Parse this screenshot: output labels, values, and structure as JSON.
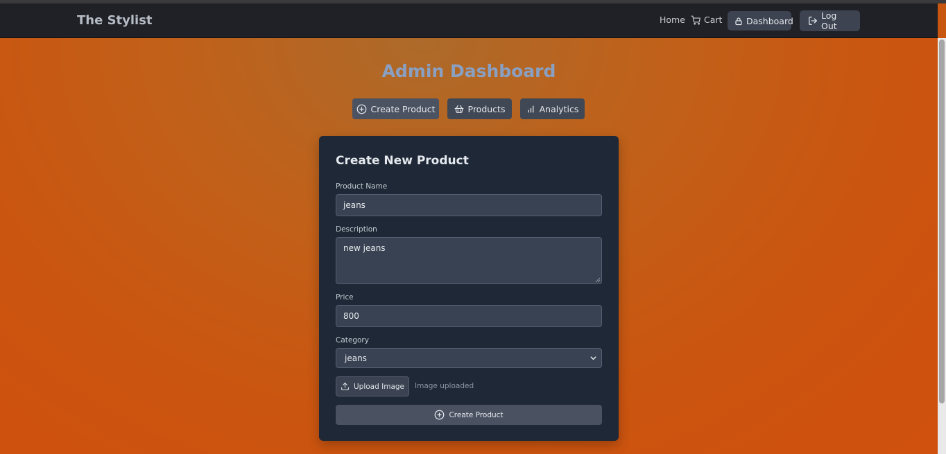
{
  "navbar": {
    "brand": "The Stylist",
    "home": "Home",
    "cart": "Cart",
    "dashboard": "Dashboard",
    "logout": "Log Out"
  },
  "page": {
    "title": "Admin Dashboard",
    "tabs": [
      {
        "label": "Create Product",
        "icon": "plus-circle-icon"
      },
      {
        "label": "Products",
        "icon": "basket-icon"
      },
      {
        "label": "Analytics",
        "icon": "bar-chart-icon"
      }
    ]
  },
  "form": {
    "title": "Create New Product",
    "name_label": "Product Name",
    "name_value": "jeans",
    "description_label": "Description",
    "description_value": "new jeans",
    "price_label": "Price",
    "price_value": "800",
    "category_label": "Category",
    "category_value": "jeans",
    "upload_label": "Upload Image",
    "upload_status": "Image uploaded",
    "submit_label": "Create Product"
  },
  "colors": {
    "navbar": "#202126",
    "background": "#c9560f",
    "card": "#1e2836",
    "title": "#8aa0c2"
  }
}
